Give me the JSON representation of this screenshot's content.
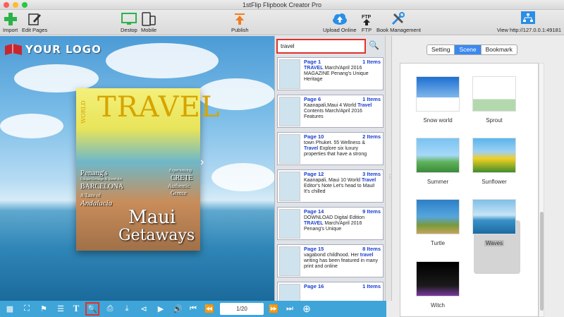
{
  "window": {
    "title": "1stFlip Flipbook Creator Pro"
  },
  "toolbar": {
    "import": "Import",
    "edit_pages": "Edit Pages",
    "desktop": "Destop",
    "mobile": "Mobile",
    "publish": "Publish",
    "upload_online": "Upload Online",
    "ftp": "FTP",
    "book_management": "Book Management",
    "view_url": "View http://127.0.0.1:49181",
    "ftp_badge": "FTP"
  },
  "stage": {
    "logo_text": "YOUR LOGO",
    "cover": {
      "title": "TRAVEL",
      "world": "WORLD",
      "penang": "Penang's",
      "penang_sub": "Unique Heritage & Street Art",
      "barcelona": "BARCELONA",
      "taste": "A Taste of",
      "andalucia": "Andalucia",
      "experiencing": "Experiencing",
      "crete": "CRETE",
      "authentic": "Authentic",
      "greece": "Greece",
      "maui": "Maui",
      "getaways": "Getaways"
    }
  },
  "search": {
    "query": "travel",
    "results": [
      {
        "page": "Page 1",
        "count": "1 Items",
        "text_pre": "",
        "hl": "TRAVEL",
        "text_post": " March/April 2016 MAGAZINE Penang's Unique Heritage"
      },
      {
        "page": "Page 6",
        "count": "1 Items",
        "text_pre": "Kaanapali,Maui 4 World ",
        "hl": "Travel",
        "text_post": " Contents March/April 2016 Features"
      },
      {
        "page": "Page 10",
        "count": "2 Items",
        "text_pre": "town Phuket. 55 Wellness & ",
        "hl": "Travel",
        "text_post": " Explore six luxury properties that have a strong"
      },
      {
        "page": "Page 12",
        "count": "3 Items",
        "text_pre": "Kaanapali, Maui 10 World ",
        "hl": "Travel",
        "text_post": " Editor's Note Let's head to Maui! It's chilled"
      },
      {
        "page": "Page 14",
        "count": "9 Items",
        "text_pre": "DOWNLOAD Digital Edition ",
        "hl": "TRAVEL",
        "text_post": " March/April 2016 Penang's Unique"
      },
      {
        "page": "Page 15",
        "count": "8 Items",
        "text_pre": "vagabond childhood. Her ",
        "hl": "travel",
        "text_post": " writing has been featured in many print and online"
      },
      {
        "page": "Page 16",
        "count": "1 Items",
        "text_pre": "",
        "hl": "",
        "text_post": ""
      }
    ]
  },
  "pager": {
    "value": "1/20"
  },
  "right_panel": {
    "tabs": [
      "Setting",
      "Scene",
      "Bookmark"
    ],
    "active_tab": "Scene",
    "scenes": [
      "Snow world",
      "Sprout",
      "Summer",
      "Sunflower",
      "Turtle",
      "Waves",
      "Witch"
    ],
    "selected_scene": "Waves"
  },
  "colors": {
    "accent_blue": "#3fa5d8",
    "highlight_red": "#e0322a",
    "link_blue": "#1a3fd0",
    "tab_active": "#3b89f0"
  }
}
